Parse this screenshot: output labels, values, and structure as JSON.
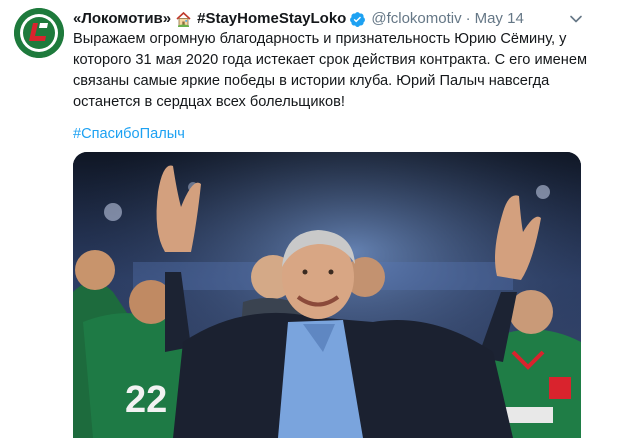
{
  "tweet": {
    "display_name": "«Локомотив»",
    "name_tag": "#StayHomeStayLoko",
    "handle": "@fclokomotiv",
    "separator": "·",
    "time": "May 14",
    "text": "Выражаем огромную благодарность и признательность Юрию Сёмину, у которого 31 мая 2020 года истекает срок действия контракта. С его именем связаны самые яркие победы в истории клуба. Юрий Палыч навсегда останется в сердцах всех болельщиков!",
    "hashtag": "#СпасибоПалыч",
    "icons": {
      "avatar": "lokomotiv-logo-avatar",
      "house": "house-emoji-icon",
      "verified": "verified-badge-icon",
      "more": "chevron-down-icon"
    },
    "photo_jersey_number": "22",
    "colors": {
      "link": "#1da1f2",
      "muted": "#657786",
      "text": "#14171a",
      "brand_green": "#1e7a3c",
      "brand_red": "#d9232d"
    }
  }
}
